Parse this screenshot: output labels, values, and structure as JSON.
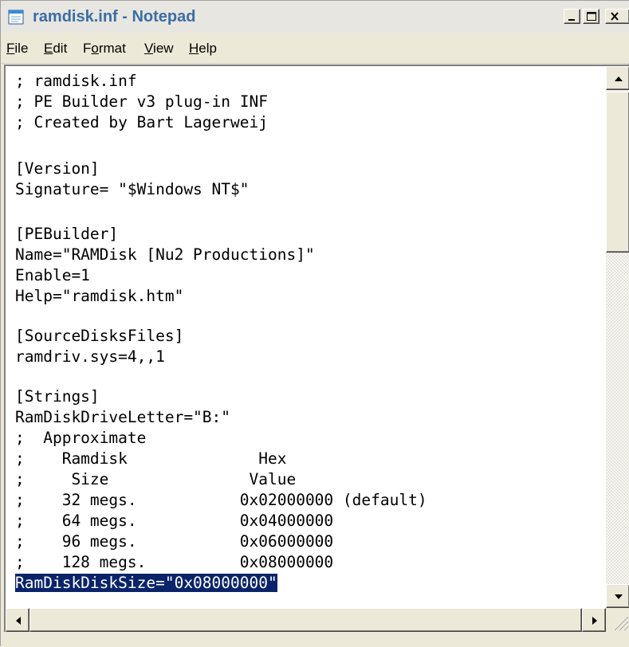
{
  "window": {
    "title": "ramdisk.inf - Notepad",
    "accent_color": "#3a6ea5",
    "selection_color": "#0a246a"
  },
  "titlebar": {
    "app_icon": "notepad-icon",
    "minimize_icon": "minimize-icon",
    "maximize_icon": "maximize-icon",
    "close_icon": "close-icon"
  },
  "menu": {
    "items": [
      {
        "label_u": "F",
        "label_rest": "ile"
      },
      {
        "label_u": "E",
        "label_rest": "dit"
      },
      {
        "label_pre": "F",
        "label_u": "o",
        "label_rest": "rmat"
      },
      {
        "label_u": "V",
        "label_rest": "iew"
      },
      {
        "label_u": "H",
        "label_rest": "elp"
      }
    ]
  },
  "editor": {
    "lines": [
      "; ramdisk.inf",
      "; PE Builder v3 plug-in INF",
      "; Created by Bart Lagerweij",
      "",
      "[Version]",
      "Signature= \"$Windows NT$\"",
      "",
      "[PEBuilder]",
      "Name=\"RAMDisk [Nu2 Productions]\"",
      "Enable=1",
      "Help=\"ramdisk.htm\"",
      "",
      "[SourceDisksFiles]",
      "ramdriv.sys=4,,1",
      "",
      "[Strings]",
      "RamDiskDriveLetter=\"B:\"",
      ";  Approximate",
      ";    Ramdisk              Hex",
      ";     Size               Value",
      ";    32 megs.           0x02000000 (default)",
      ";    64 megs.           0x04000000",
      ";    96 megs.           0x06000000",
      ";    128 megs.          0x08000000"
    ],
    "selected_line": "RamDiskDiskSize=\"0x08000000\""
  },
  "scrollbars": {
    "up_icon": "scroll-up-arrow-icon",
    "down_icon": "scroll-down-arrow-icon",
    "left_icon": "scroll-left-arrow-icon",
    "right_icon": "scroll-right-arrow-icon",
    "resize_grip_icon": "resize-grip-icon"
  }
}
